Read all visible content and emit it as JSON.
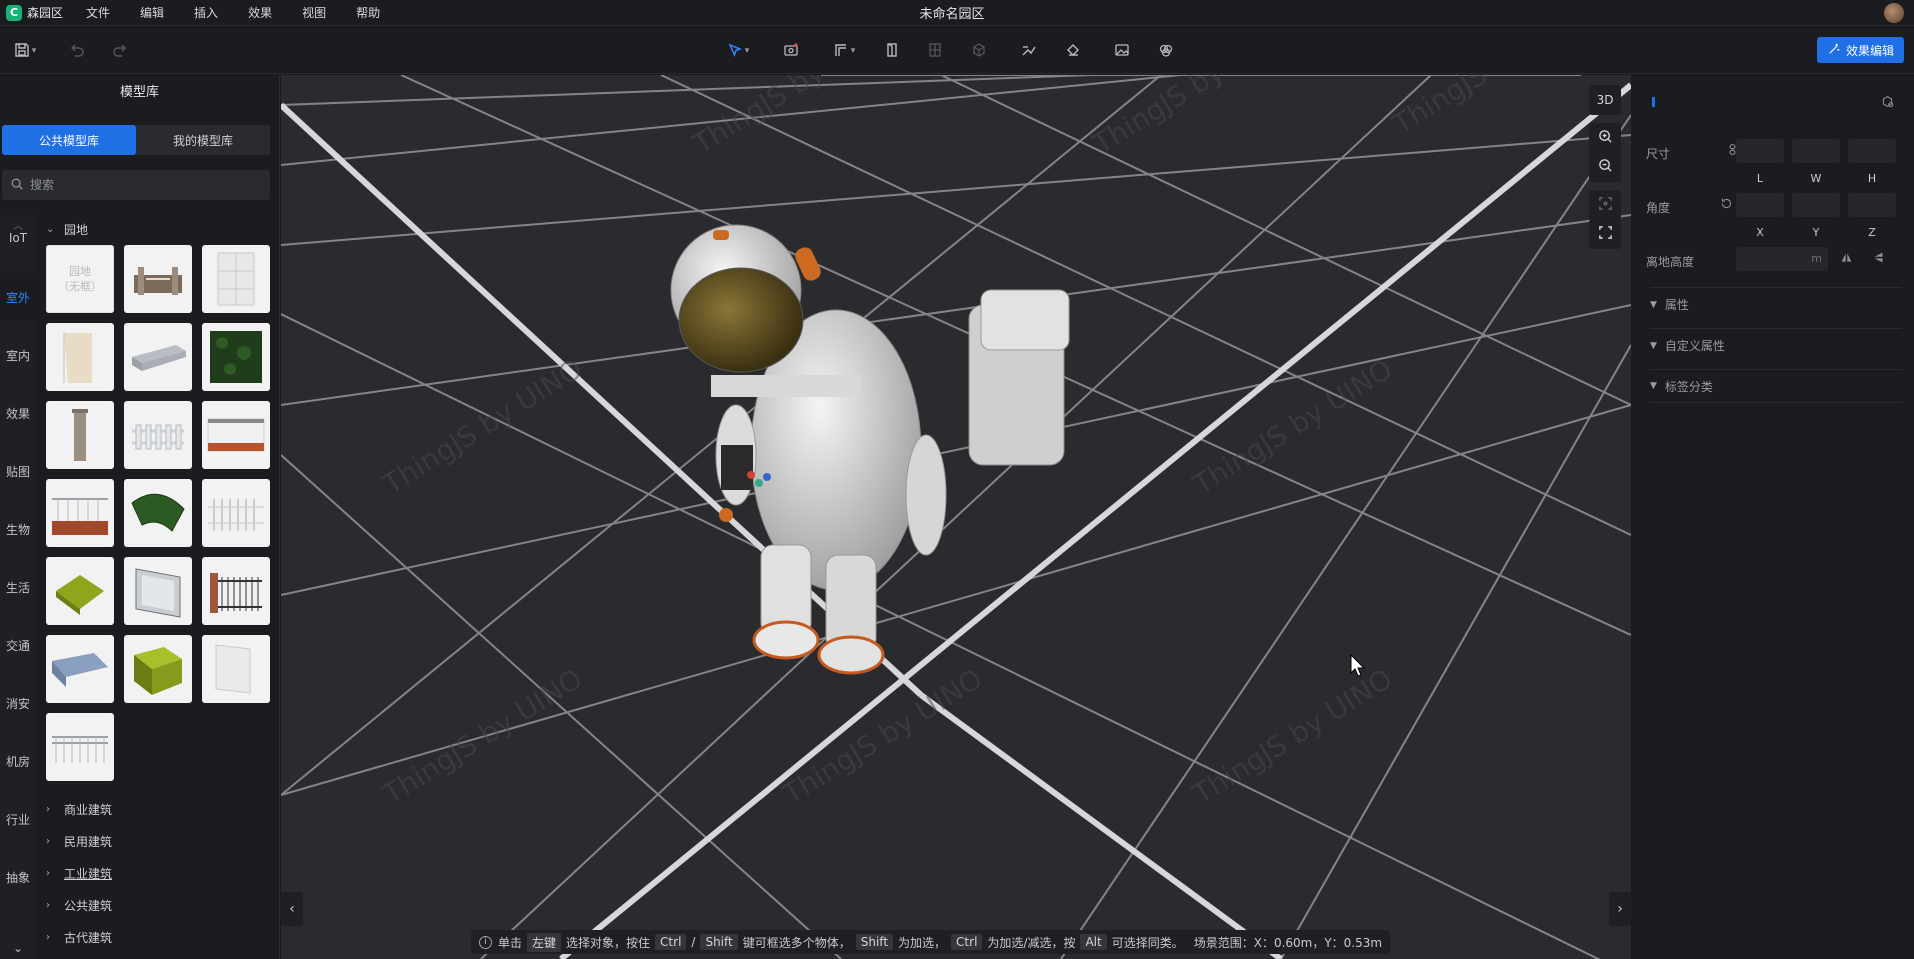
{
  "menubar": {
    "app_logo_letter": "C",
    "app_name": "森园区",
    "menus": [
      "文件",
      "编辑",
      "插入",
      "效果",
      "视图",
      "帮助"
    ],
    "doc_title": "未命名园区"
  },
  "toolbar": {
    "effect_edit_label": "效果编辑",
    "icons": [
      "save-icon",
      "undo-icon",
      "redo-icon",
      "select-pointer-icon",
      "capture-icon",
      "wall-path-icon",
      "door-icon",
      "window-icon",
      "cube-icon",
      "line-icon",
      "paint-bucket-icon",
      "image-icon",
      "sphere-icon"
    ],
    "accent_color": "#1f6fe5"
  },
  "left_panel": {
    "title": "模型库",
    "tabs": [
      "公共模型库",
      "我的模型库"
    ],
    "active_tab": "公共模型库",
    "search_placeholder": "搜索",
    "categories": [
      "IoT",
      "室外",
      "室内",
      "效果",
      "贴图",
      "生物",
      "生活",
      "交通",
      "消安",
      "机房",
      "行业",
      "抽象"
    ],
    "active_category": "室外",
    "expanded_group": "园地",
    "first_tile_text": [
      "园地",
      "（无框）"
    ],
    "collapsed_groups": [
      "商业建筑",
      "民用建筑",
      "工业建筑",
      "公共建筑",
      "古代建筑"
    ]
  },
  "viewport": {
    "mode_label": "3D",
    "watermark": "ThingJS by UINO",
    "status": {
      "click": "单击",
      "left_key": "左键",
      "select_text": "选择对象，按住",
      "ctrl_key": "Ctrl",
      "slash": "/",
      "shift_key": "Shift",
      "multi_text": "键可框选多个物体，",
      "shift_key2": "Shift",
      "add_text": "为加选，",
      "ctrl_key2": "Ctrl",
      "addsub_text": "为加选/减选，按",
      "alt_key": "Alt",
      "same_text": "可选择同类。",
      "scene_range": "场景范围：X：0.60m，Y：0.53m"
    }
  },
  "right_panel": {
    "size_label": "尺寸",
    "size_axes": [
      "L",
      "W",
      "H"
    ],
    "angle_label": "角度",
    "angle_axes": [
      "X",
      "Y",
      "Z"
    ],
    "height_label": "离地高度",
    "height_unit": "m",
    "sections": [
      "属性",
      "自定义属性",
      "标签分类"
    ]
  }
}
